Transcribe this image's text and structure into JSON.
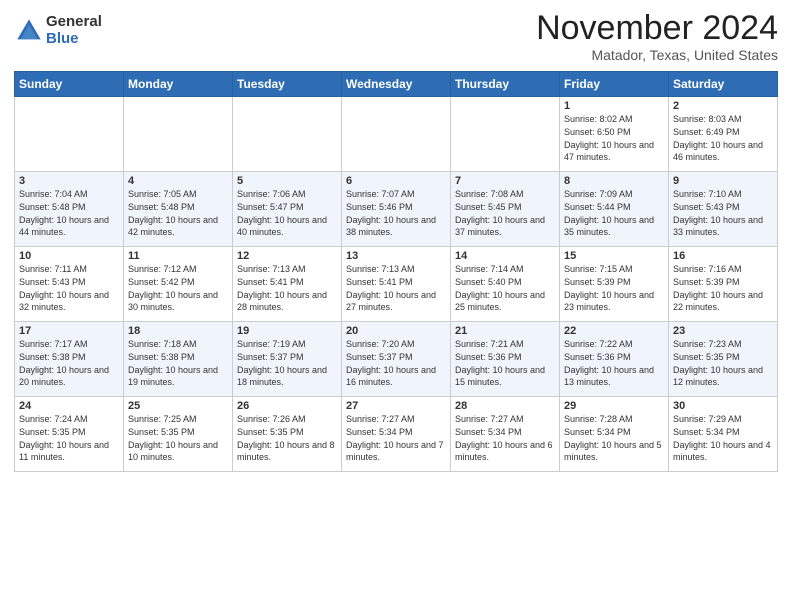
{
  "header": {
    "logo_general": "General",
    "logo_blue": "Blue",
    "month_title": "November 2024",
    "location": "Matador, Texas, United States"
  },
  "weekdays": [
    "Sunday",
    "Monday",
    "Tuesday",
    "Wednesday",
    "Thursday",
    "Friday",
    "Saturday"
  ],
  "weeks": [
    [
      {
        "day": "",
        "info": ""
      },
      {
        "day": "",
        "info": ""
      },
      {
        "day": "",
        "info": ""
      },
      {
        "day": "",
        "info": ""
      },
      {
        "day": "",
        "info": ""
      },
      {
        "day": "1",
        "info": "Sunrise: 8:02 AM\nSunset: 6:50 PM\nDaylight: 10 hours and 47 minutes."
      },
      {
        "day": "2",
        "info": "Sunrise: 8:03 AM\nSunset: 6:49 PM\nDaylight: 10 hours and 46 minutes."
      }
    ],
    [
      {
        "day": "3",
        "info": "Sunrise: 7:04 AM\nSunset: 5:48 PM\nDaylight: 10 hours and 44 minutes."
      },
      {
        "day": "4",
        "info": "Sunrise: 7:05 AM\nSunset: 5:48 PM\nDaylight: 10 hours and 42 minutes."
      },
      {
        "day": "5",
        "info": "Sunrise: 7:06 AM\nSunset: 5:47 PM\nDaylight: 10 hours and 40 minutes."
      },
      {
        "day": "6",
        "info": "Sunrise: 7:07 AM\nSunset: 5:46 PM\nDaylight: 10 hours and 38 minutes."
      },
      {
        "day": "7",
        "info": "Sunrise: 7:08 AM\nSunset: 5:45 PM\nDaylight: 10 hours and 37 minutes."
      },
      {
        "day": "8",
        "info": "Sunrise: 7:09 AM\nSunset: 5:44 PM\nDaylight: 10 hours and 35 minutes."
      },
      {
        "day": "9",
        "info": "Sunrise: 7:10 AM\nSunset: 5:43 PM\nDaylight: 10 hours and 33 minutes."
      }
    ],
    [
      {
        "day": "10",
        "info": "Sunrise: 7:11 AM\nSunset: 5:43 PM\nDaylight: 10 hours and 32 minutes."
      },
      {
        "day": "11",
        "info": "Sunrise: 7:12 AM\nSunset: 5:42 PM\nDaylight: 10 hours and 30 minutes."
      },
      {
        "day": "12",
        "info": "Sunrise: 7:13 AM\nSunset: 5:41 PM\nDaylight: 10 hours and 28 minutes."
      },
      {
        "day": "13",
        "info": "Sunrise: 7:13 AM\nSunset: 5:41 PM\nDaylight: 10 hours and 27 minutes."
      },
      {
        "day": "14",
        "info": "Sunrise: 7:14 AM\nSunset: 5:40 PM\nDaylight: 10 hours and 25 minutes."
      },
      {
        "day": "15",
        "info": "Sunrise: 7:15 AM\nSunset: 5:39 PM\nDaylight: 10 hours and 23 minutes."
      },
      {
        "day": "16",
        "info": "Sunrise: 7:16 AM\nSunset: 5:39 PM\nDaylight: 10 hours and 22 minutes."
      }
    ],
    [
      {
        "day": "17",
        "info": "Sunrise: 7:17 AM\nSunset: 5:38 PM\nDaylight: 10 hours and 20 minutes."
      },
      {
        "day": "18",
        "info": "Sunrise: 7:18 AM\nSunset: 5:38 PM\nDaylight: 10 hours and 19 minutes."
      },
      {
        "day": "19",
        "info": "Sunrise: 7:19 AM\nSunset: 5:37 PM\nDaylight: 10 hours and 18 minutes."
      },
      {
        "day": "20",
        "info": "Sunrise: 7:20 AM\nSunset: 5:37 PM\nDaylight: 10 hours and 16 minutes."
      },
      {
        "day": "21",
        "info": "Sunrise: 7:21 AM\nSunset: 5:36 PM\nDaylight: 10 hours and 15 minutes."
      },
      {
        "day": "22",
        "info": "Sunrise: 7:22 AM\nSunset: 5:36 PM\nDaylight: 10 hours and 13 minutes."
      },
      {
        "day": "23",
        "info": "Sunrise: 7:23 AM\nSunset: 5:35 PM\nDaylight: 10 hours and 12 minutes."
      }
    ],
    [
      {
        "day": "24",
        "info": "Sunrise: 7:24 AM\nSunset: 5:35 PM\nDaylight: 10 hours and 11 minutes."
      },
      {
        "day": "25",
        "info": "Sunrise: 7:25 AM\nSunset: 5:35 PM\nDaylight: 10 hours and 10 minutes."
      },
      {
        "day": "26",
        "info": "Sunrise: 7:26 AM\nSunset: 5:35 PM\nDaylight: 10 hours and 8 minutes."
      },
      {
        "day": "27",
        "info": "Sunrise: 7:27 AM\nSunset: 5:34 PM\nDaylight: 10 hours and 7 minutes."
      },
      {
        "day": "28",
        "info": "Sunrise: 7:27 AM\nSunset: 5:34 PM\nDaylight: 10 hours and 6 minutes."
      },
      {
        "day": "29",
        "info": "Sunrise: 7:28 AM\nSunset: 5:34 PM\nDaylight: 10 hours and 5 minutes."
      },
      {
        "day": "30",
        "info": "Sunrise: 7:29 AM\nSunset: 5:34 PM\nDaylight: 10 hours and 4 minutes."
      }
    ]
  ]
}
